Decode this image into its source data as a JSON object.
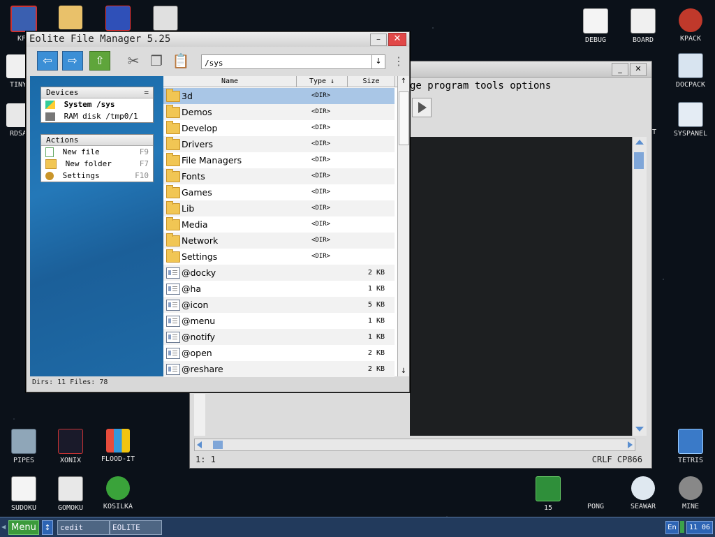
{
  "desktop": {
    "icons_left": [
      "KFM",
      "TINY",
      "RDSA"
    ],
    "icons_right": [
      "DEBUG",
      "BOARD",
      "KPACK",
      "DOCPACK",
      "SYSPANEL",
      "IT"
    ],
    "icons_bottom_left": [
      "PIPES",
      "XONIX",
      "FLOOD-IT",
      "SUDOKU",
      "GOMOKU",
      "KOSILKA"
    ],
    "icons_bottom_right": [
      "TETRIS",
      "15",
      "PONG",
      "SEAWAR",
      "MINE"
    ]
  },
  "cedit": {
    "menu": "ge program tools options",
    "status_pos": "1: 1",
    "status_enc": "CRLF  CP866"
  },
  "fm": {
    "title": "Eolite File Manager 5.25",
    "path": "/sys",
    "devices": {
      "header": "Devices",
      "items": [
        {
          "label": "System /sys"
        },
        {
          "label": "RAM disk /tmp0/1"
        }
      ]
    },
    "actions": {
      "header": "Actions",
      "items": [
        {
          "label": "New file",
          "key": "F9"
        },
        {
          "label": "New folder",
          "key": "F7"
        },
        {
          "label": "Settings",
          "key": "F10"
        }
      ]
    },
    "columns": {
      "name": "Name",
      "type": "Type ↓",
      "size": "Size"
    },
    "files": [
      {
        "name": "3d",
        "type": "<DIR>",
        "size": ""
      },
      {
        "name": "Demos",
        "type": "<DIR>",
        "size": ""
      },
      {
        "name": "Develop",
        "type": "<DIR>",
        "size": ""
      },
      {
        "name": "Drivers",
        "type": "<DIR>",
        "size": ""
      },
      {
        "name": "File Managers",
        "type": "<DIR>",
        "size": ""
      },
      {
        "name": "Fonts",
        "type": "<DIR>",
        "size": ""
      },
      {
        "name": "Games",
        "type": "<DIR>",
        "size": ""
      },
      {
        "name": "Lib",
        "type": "<DIR>",
        "size": ""
      },
      {
        "name": "Media",
        "type": "<DIR>",
        "size": ""
      },
      {
        "name": "Network",
        "type": "<DIR>",
        "size": ""
      },
      {
        "name": "Settings",
        "type": "<DIR>",
        "size": ""
      },
      {
        "name": "@docky",
        "type": "",
        "size": "2 KB"
      },
      {
        "name": "@ha",
        "type": "",
        "size": "1 KB"
      },
      {
        "name": "@icon",
        "type": "",
        "size": "5 KB"
      },
      {
        "name": "@menu",
        "type": "",
        "size": "1 KB"
      },
      {
        "name": "@notify",
        "type": "",
        "size": "1 KB"
      },
      {
        "name": "@open",
        "type": "",
        "size": "2 KB"
      },
      {
        "name": "@reshare",
        "type": "",
        "size": "2 KB"
      }
    ],
    "status": "Dirs: 11   Files: 78"
  },
  "taskbar": {
    "menu_label": "Menu",
    "tasks": [
      "cedit",
      "EOLITE"
    ],
    "lang": "En",
    "clock": "11 06"
  }
}
